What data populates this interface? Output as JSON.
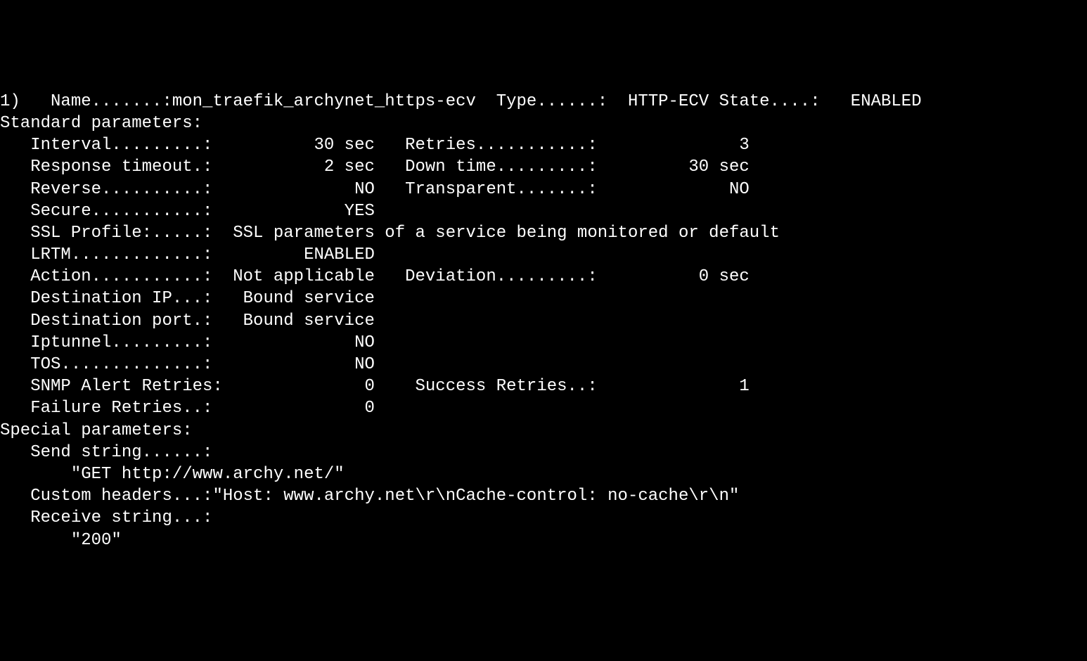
{
  "header": {
    "index": "1)",
    "name_label": "Name.......:",
    "name_value": "mon_traefik_archynet_https-ecv",
    "type_label": "Type......:",
    "type_value": "HTTP-ECV",
    "state_label": "State....:",
    "state_value": "ENABLED"
  },
  "standard_header": "Standard parameters:",
  "rows": [
    {
      "l1": "Interval.........:",
      "v1": "30 sec",
      "l2": "Retries...........:",
      "v2": "3"
    },
    {
      "l1": "Response timeout.:",
      "v1": "2 sec",
      "l2": "Down time.........:",
      "v2": "30 sec"
    },
    {
      "l1": "Reverse..........:",
      "v1": "NO",
      "l2": "Transparent.......:",
      "v2": "NO"
    },
    {
      "l1": "Secure...........:",
      "v1": "YES",
      "l2": "",
      "v2": ""
    },
    {
      "l1": "SSL Profile:.....:",
      "v1_long": "SSL parameters of a service being monitored or default"
    },
    {
      "l1": "LRTM.............:",
      "v1": "ENABLED",
      "l2": "",
      "v2": ""
    },
    {
      "l1": "Action...........:",
      "v1": "Not applicable",
      "l2": "Deviation.........:",
      "v2": "0 sec"
    },
    {
      "l1": "Destination IP...:",
      "v1": "Bound service",
      "l2": "",
      "v2": ""
    },
    {
      "l1": "Destination port.:",
      "v1": "Bound service",
      "l2": "",
      "v2": ""
    },
    {
      "l1": "Iptunnel.........:",
      "v1": "NO",
      "l2": "",
      "v2": ""
    },
    {
      "l1": "TOS..............:",
      "v1": "NO",
      "l2": "",
      "v2": ""
    },
    {
      "l1": "SNMP Alert Retries:",
      "v1": "0",
      "l2": " Success Retries..:",
      "v2": "1"
    },
    {
      "l1": "Failure Retries..:",
      "v1": "0",
      "l2": "",
      "v2": ""
    }
  ],
  "special_header": "Special parameters:",
  "send_string_label": "Send string......:",
  "send_string_value": "\"GET http://www.archy.net/\"",
  "custom_headers_label": "Custom headers...:",
  "custom_headers_value": "\"Host: www.archy.net\\r\\nCache-control: no-cache\\r\\n\"",
  "receive_string_label": "Receive string...:",
  "receive_string_value": "\"200\""
}
